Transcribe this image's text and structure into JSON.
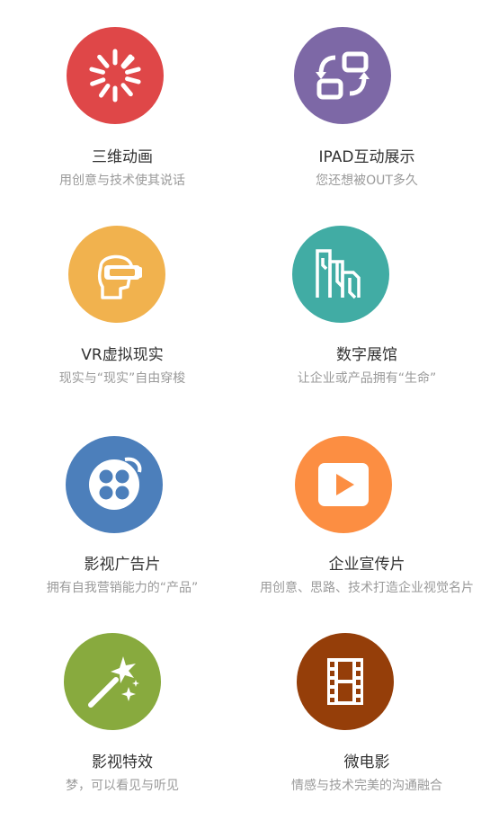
{
  "services": [
    {
      "title": "三维动画",
      "subtitle": "用创意与技术使其说话",
      "color": "#df4748",
      "icon": "spinner-icon"
    },
    {
      "title": "IPAD互动展示",
      "subtitle": "您还想被OUT多久",
      "color": "#7d68a6",
      "icon": "swap-screens-icon"
    },
    {
      "title": "VR虚拟现实",
      "subtitle": "现实与“现实”自由穿梭",
      "color": "#f1b24e",
      "icon": "vr-headset-icon"
    },
    {
      "title": "数字展馆",
      "subtitle": "让企业或产品拥有“生命”",
      "color": "#41aca4",
      "icon": "exhibition-hall-icon"
    },
    {
      "title": "影视广告片",
      "subtitle": "拥有自我营销能力的“产品”",
      "color": "#4c7fbb",
      "icon": "film-reel-icon"
    },
    {
      "title": "企业宣传片",
      "subtitle": "用创意、思路、技术打造企业视觉名片",
      "color": "#fc8e42",
      "icon": "play-button-icon"
    },
    {
      "title": "影视特效",
      "subtitle": "梦，可以看见与听见",
      "color": "#88aa3e",
      "icon": "magic-wand-icon"
    },
    {
      "title": "微电影",
      "subtitle": "情感与技术完美的沟通融合",
      "color": "#953e09",
      "icon": "film-strip-icon"
    }
  ]
}
